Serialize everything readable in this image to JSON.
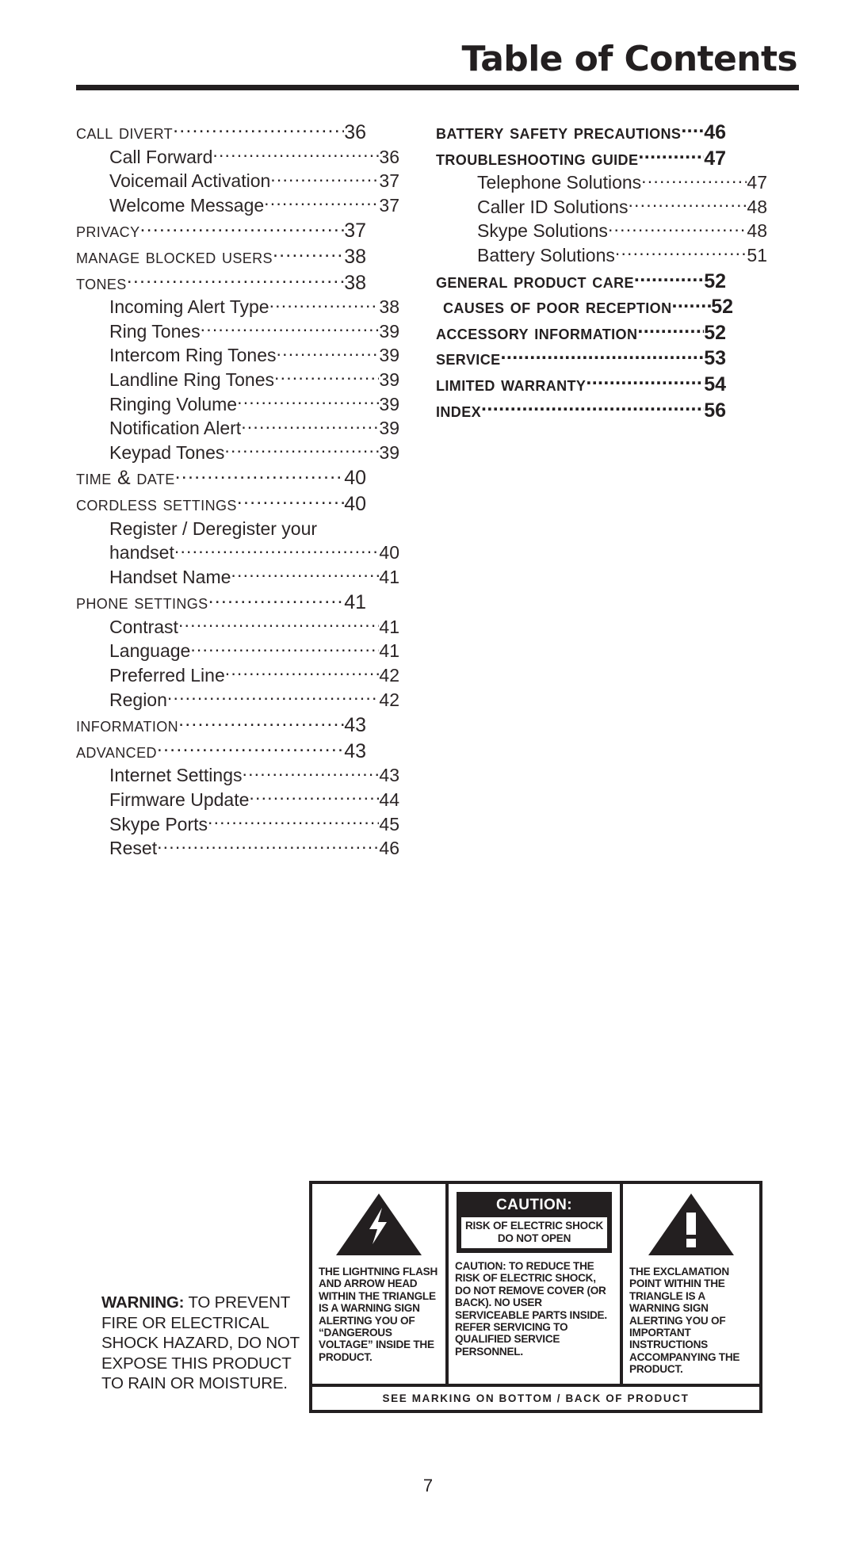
{
  "header": {
    "title": "Table of Contents"
  },
  "toc": {
    "left_column": [
      {
        "level": 1,
        "label": "Call Divert",
        "page": "36"
      },
      {
        "level": 2,
        "label": "Call Forward",
        "page": "36"
      },
      {
        "level": 2,
        "label": "Voicemail Activation",
        "page": "37"
      },
      {
        "level": 2,
        "label": "Welcome Message",
        "page": "37"
      },
      {
        "level": 1,
        "label": "Privacy",
        "page": "37"
      },
      {
        "level": 1,
        "label": "Manage Blocked Users",
        "page": "38"
      },
      {
        "level": 1,
        "label": "Tones",
        "page": "38"
      },
      {
        "level": 2,
        "label": "Incoming Alert Type",
        "page": "38"
      },
      {
        "level": 2,
        "label": "Ring Tones",
        "page": "39"
      },
      {
        "level": 2,
        "label": "Intercom Ring Tones",
        "page": "39"
      },
      {
        "level": 2,
        "label": "Landline Ring Tones",
        "page": "39"
      },
      {
        "level": 2,
        "label": "Ringing Volume",
        "page": "39"
      },
      {
        "level": 2,
        "label": "Notification Alert",
        "page": "39"
      },
      {
        "level": 2,
        "label": "Keypad Tones",
        "page": "39"
      },
      {
        "level": 1,
        "label": "Time & Date",
        "page": "40"
      },
      {
        "level": 1,
        "label": "Cordless Settings",
        "page": "40"
      },
      {
        "level": 2,
        "label": "Register / Deregister your",
        "page": "",
        "wrap": true
      },
      {
        "level": 2,
        "label": "handset",
        "page": "40"
      },
      {
        "level": 2,
        "label": "Handset Name",
        "page": "41"
      },
      {
        "level": 1,
        "label": "Phone Settings",
        "page": "41"
      },
      {
        "level": 2,
        "label": "Contrast",
        "page": "41"
      },
      {
        "level": 2,
        "label": "Language",
        "page": "41"
      },
      {
        "level": 2,
        "label": "Preferred Line",
        "page": "42"
      },
      {
        "level": 2,
        "label": "Region",
        "page": "42"
      },
      {
        "level": 1,
        "label": "Information",
        "page": "43"
      },
      {
        "level": 1,
        "label": "Advanced",
        "page": "43"
      },
      {
        "level": 2,
        "label": "Internet Settings",
        "page": "43"
      },
      {
        "level": 2,
        "label": "Firmware Update",
        "page": "44"
      },
      {
        "level": 2,
        "label": "Skype Ports",
        "page": "45"
      },
      {
        "level": 2,
        "label": "Reset",
        "page": "46"
      }
    ],
    "right_column": [
      {
        "level": 1,
        "label": "Battery Safety Precautions",
        "page": "46"
      },
      {
        "level": 1,
        "label": "Troubleshooting Guide",
        "page": "47"
      },
      {
        "level": 2,
        "label": "Telephone Solutions",
        "page": "47"
      },
      {
        "level": 2,
        "label": "Caller ID Solutions",
        "page": "48"
      },
      {
        "level": 2,
        "label": "Skype Solutions",
        "page": "48"
      },
      {
        "level": 2,
        "label": "Battery Solutions",
        "page": "51"
      },
      {
        "level": 1,
        "label": "General Product Care",
        "page": "52"
      },
      {
        "level": 1,
        "label": "Causes of Poor Reception",
        "page": "52",
        "indent": true
      },
      {
        "level": 1,
        "label": "Accessory Information",
        "page": "52"
      },
      {
        "level": 1,
        "label": "Service",
        "page": "53"
      },
      {
        "level": 1,
        "label": "Limited Warranty",
        "page": "54"
      },
      {
        "level": 1,
        "label": "Index",
        "page": "56"
      }
    ]
  },
  "safety": {
    "warning_bold": "WARNING:",
    "warning_text": " TO PREVENT FIRE OR ELECTRICAL SHOCK HAZARD, DO NOT EXPOSE THIS PRODUCT TO RAIN OR MOISTURE.",
    "lightning_body": "THE LIGHTNING FLASH AND ARROW HEAD WITHIN THE TRIANGLE IS A WARNING SIGN ALERTING YOU OF “DANGEROUS VOLTAGE” INSIDE THE PRODUCT.",
    "caution_title": "CAUTION:",
    "caution_sub_line1": "RISK OF ELECTRIC SHOCK",
    "caution_sub_line2": "DO NOT OPEN",
    "caution_body": "CAUTION: TO REDUCE THE RISK OF ELECTRIC SHOCK, DO NOT REMOVE COVER (OR BACK). NO USER SERVICEABLE PARTS INSIDE. REFER SERVICING TO QUALIFIED SERVICE PERSONNEL.",
    "exclamation_body": "THE EXCLAMATION POINT WITHIN THE TRIANGLE IS A WARNING SIGN ALERTING YOU OF IMPORTANT INSTRUCTIONS ACCOMPANYING THE PRODUCT.",
    "footer": "SEE MARKING ON BOTTOM / BACK OF PRODUCT"
  },
  "folio": "7"
}
